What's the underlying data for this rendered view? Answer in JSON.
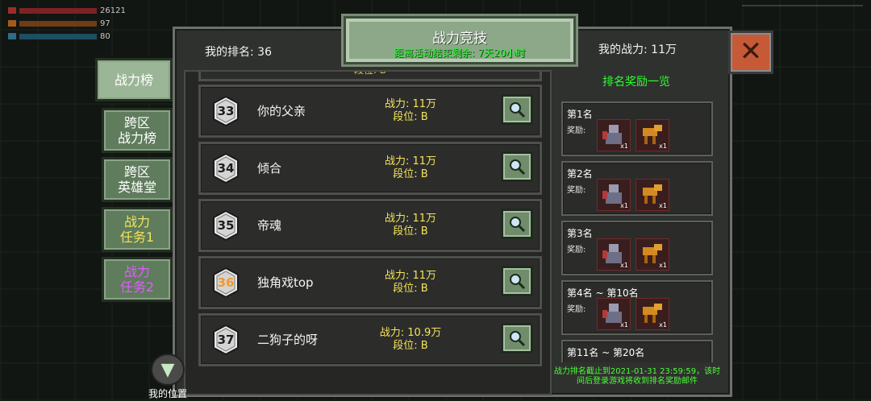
{
  "hud": {
    "stat1": "26121",
    "stat2": "97",
    "stat3": "80"
  },
  "header": {
    "title": "战力竞技",
    "subtitle": "距离活动结束剩余: 7天20小时",
    "my_rank": "我的排名: 36",
    "my_power": "我的战力: 11万"
  },
  "tabs": [
    {
      "label": "战力榜",
      "active": true,
      "color": "#ffffff"
    },
    {
      "label": "跨区\n战力榜",
      "active": false,
      "color": "#ffffff"
    },
    {
      "label": "跨区\n英雄堂",
      "active": false,
      "color": "#ffffff"
    },
    {
      "label": "战力\n任务1",
      "active": false,
      "color": "#f5e35a"
    },
    {
      "label": "战力\n任务2",
      "active": false,
      "color": "#e15dff"
    }
  ],
  "partial_row": {
    "text": "段位: B"
  },
  "rankings": [
    {
      "rank": "33",
      "name": "你的父亲",
      "power": "战力: 11万",
      "tier": "段位: B",
      "highlight": false
    },
    {
      "rank": "34",
      "name": "倾合",
      "power": "战力: 11万",
      "tier": "段位: B",
      "highlight": false
    },
    {
      "rank": "35",
      "name": "帝魂",
      "power": "战力: 11万",
      "tier": "段位: B",
      "highlight": false
    },
    {
      "rank": "36",
      "name": "独角戏top",
      "power": "战力: 11万",
      "tier": "段位: B",
      "highlight": true
    },
    {
      "rank": "37",
      "name": "二狗子的呀",
      "power": "战力: 10.9万",
      "tier": "段位: B",
      "highlight": false
    }
  ],
  "my_position": {
    "label": "我的位置"
  },
  "rewards": {
    "title": "排名奖励一览",
    "reward_label": "奖励:",
    "tiers": [
      {
        "label": "第1名",
        "items": [
          {
            "qty": "x1"
          },
          {
            "qty": "x1"
          }
        ]
      },
      {
        "label": "第2名",
        "items": [
          {
            "qty": "x1"
          },
          {
            "qty": "x1"
          }
        ]
      },
      {
        "label": "第3名",
        "items": [
          {
            "qty": "x1"
          },
          {
            "qty": "x1"
          }
        ]
      },
      {
        "label": "第4名 ~ 第10名",
        "items": [
          {
            "qty": "x1"
          },
          {
            "qty": "x1"
          }
        ]
      },
      {
        "label": "第11名 ~ 第20名",
        "items": []
      }
    ],
    "footer": "战力排名截止到2021-01-31 23:59:59，该时间后登录游戏将收到排名奖励邮件"
  },
  "colors": {
    "accent_green": "#2dff32",
    "power_yellow": "#f5e35a",
    "close_red": "#c75a36"
  }
}
